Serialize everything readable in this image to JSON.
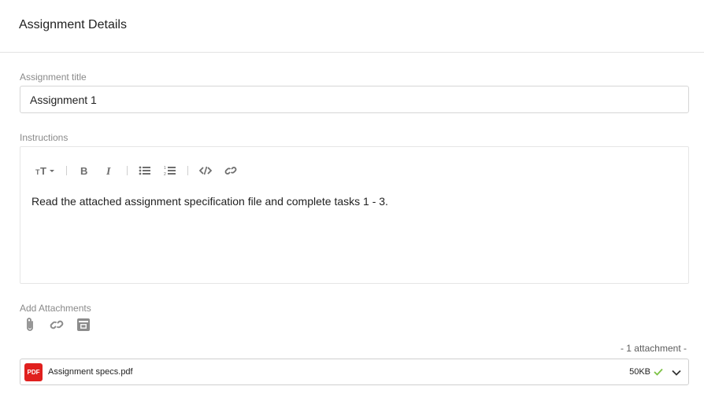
{
  "header": {
    "title": "Assignment Details"
  },
  "form": {
    "title_label": "Assignment title",
    "title_value": "Assignment 1",
    "instructions_label": "Instructions",
    "instructions_text": "Read the attached assignment specification file and complete tasks 1 - 3.",
    "attachments_label": "Add Attachments"
  },
  "toolbar": {
    "icons": [
      "text-size-icon",
      "bold-icon",
      "italic-icon",
      "bullet-list-icon",
      "numbered-list-icon",
      "code-icon",
      "link-icon"
    ]
  },
  "attachment_tools": [
    "paperclip-icon",
    "link-icon",
    "drive-icon"
  ],
  "attachments": {
    "count_text": "- 1 attachment  -",
    "files": [
      {
        "badge": "PDF",
        "name": "Assignment specs.pdf",
        "size": "50KB",
        "status": "uploaded"
      }
    ]
  },
  "colors": {
    "pdf_badge": "#e0201e",
    "check": "#7cc144",
    "icon_gray": "#8c8c8c"
  }
}
